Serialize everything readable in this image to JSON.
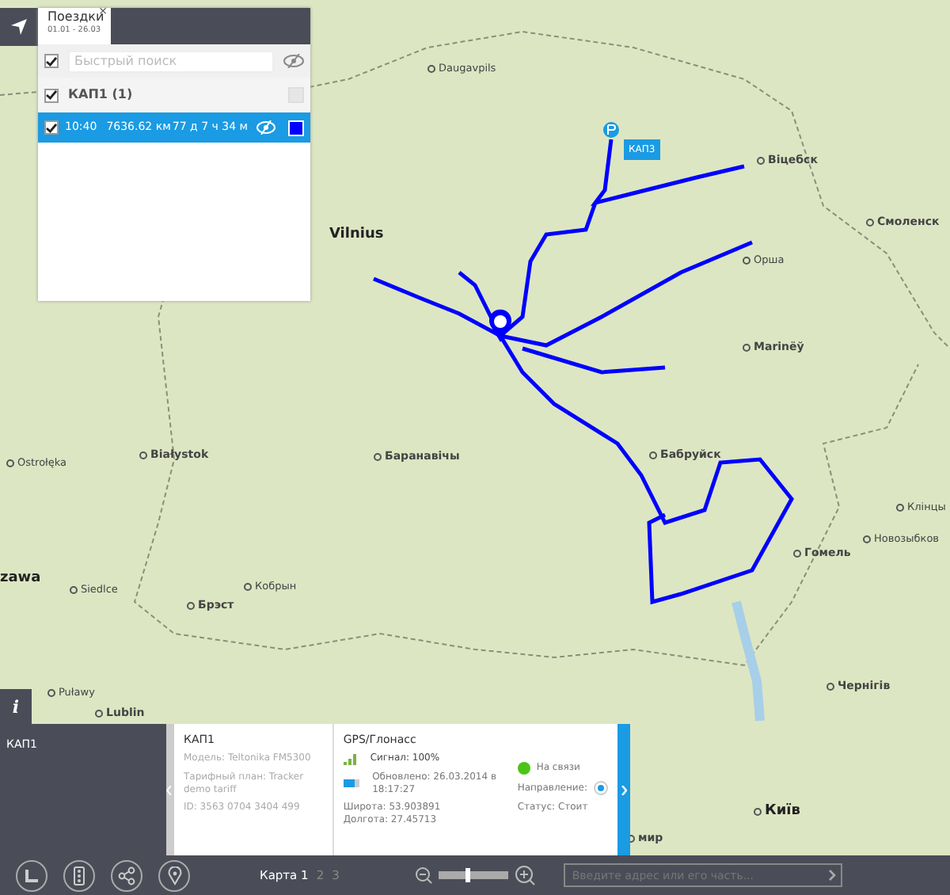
{
  "trips_panel": {
    "tab": {
      "title": "Поездки",
      "dates": "01.01 - 26.03",
      "close": "×",
      "selected": true
    },
    "select_all": {
      "checked": true
    },
    "search": {
      "placeholder": "Быстрый поиск"
    },
    "groups": [
      {
        "name": "КАП1 (1)",
        "checked": true,
        "trips": [
          {
            "time": "10:40",
            "distance": "7636.62 км",
            "duration": "77 д 7 ч 34 м",
            "checked": true,
            "selected": true,
            "color": "#0000ff"
          }
        ]
      }
    ]
  },
  "map": {
    "labels": [
      {
        "text": "Daugavpils",
        "kind": "town"
      },
      {
        "text": "Vilnius",
        "kind": "capital"
      },
      {
        "text": "Віцебск",
        "kind": "city"
      },
      {
        "text": "Смоленск",
        "kind": "city"
      },
      {
        "text": "Орша",
        "kind": "town"
      },
      {
        "text": "Marinёў",
        "kind": "city"
      },
      {
        "text": "Ostrołęka",
        "kind": "town"
      },
      {
        "text": "Białystok",
        "kind": "city"
      },
      {
        "text": "Баранавічы",
        "kind": "city"
      },
      {
        "text": "Бабруйск",
        "kind": "city"
      },
      {
        "text": "Клінцы",
        "kind": "town"
      },
      {
        "text": "Новозыбков",
        "kind": "town"
      },
      {
        "text": "Гомель",
        "kind": "city"
      },
      {
        "text": "zawa",
        "kind": "capital"
      },
      {
        "text": "Siedlce",
        "kind": "town"
      },
      {
        "text": "Кобрын",
        "kind": "town"
      },
      {
        "text": "Брэст",
        "kind": "city"
      },
      {
        "text": "Puławy",
        "kind": "town"
      },
      {
        "text": "Lublin",
        "kind": "city"
      },
      {
        "text": "Чернігів",
        "kind": "city"
      },
      {
        "text": "Київ",
        "kind": "capital"
      },
      {
        "text": "мир",
        "kind": "city"
      }
    ],
    "tags": [
      {
        "text": "КАП3"
      }
    ]
  },
  "info_button": {
    "label": "i"
  },
  "device_sidebar": {
    "name": "КАП1"
  },
  "device_card": {
    "name": "КАП1",
    "model": "Модель: Teltonika FM5300",
    "tariff": "Тарифный план: Tracker demo tariff",
    "id": "ID: 3563 0704 3404 499"
  },
  "gps": {
    "title": "GPS/Глонасс",
    "signal": "Сигнал: 100%",
    "updated": "Обновлено: 26.03.2014 в 18:17:27",
    "latitude": "Широта: 53.903891",
    "longitude": "Долгота: 27.45713",
    "connection": "На связи",
    "online": true,
    "direction": "Направление:",
    "status": "Статус: Стоит"
  },
  "toolbar": {
    "maps": [
      {
        "label": "Карта 1",
        "selected": true
      },
      {
        "label": "2",
        "selected": false
      },
      {
        "label": "3",
        "selected": false
      }
    ],
    "zoom": {
      "level": 0.4
    },
    "address": {
      "placeholder": "Введите адрес или его часть..."
    }
  }
}
